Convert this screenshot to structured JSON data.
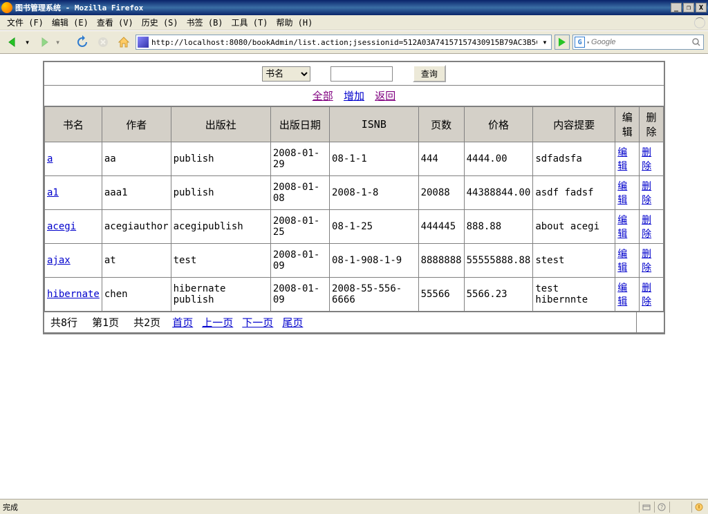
{
  "window": {
    "title": "图书管理系统 - Mozilla Firefox",
    "min": "_",
    "restore": "❐",
    "close": "X"
  },
  "menu": {
    "file": "文件 (F)",
    "edit": "编辑 (E)",
    "view": "查看 (V)",
    "history": "历史 (S)",
    "bookmarks": "书签 (B)",
    "tools": "工具 (T)",
    "help": "帮助 (H)"
  },
  "toolbar": {
    "url": "http://localhost:8080/bookAdmin/list.action;jsessionid=512A03A74157157430915B79AC3B5C",
    "search_placeholder": "Google"
  },
  "page": {
    "search_type": "书名",
    "search_button": "查询",
    "link_all": "全部",
    "link_add": "增加",
    "link_back": "返回",
    "headers": [
      "书名",
      "作者",
      "出版社",
      "出版日期",
      "ISNB",
      "页数",
      "价格",
      "内容提要",
      "编辑",
      "删除"
    ],
    "edit_label": "编辑",
    "delete_label": "删除",
    "rows": [
      {
        "name": "a",
        "author": "aa",
        "publisher": "publish",
        "date": "2008-01-29",
        "isbn": "08-1-1",
        "pages": "444",
        "price": "4444.00",
        "summary": "sdfadsfa"
      },
      {
        "name": "a1",
        "author": "aaa1",
        "publisher": "publish",
        "date": "2008-01-08",
        "isbn": "2008-1-8",
        "pages": "20088",
        "price": "44388844.00",
        "summary": "asdf fadsf"
      },
      {
        "name": "acegi",
        "author": "acegiauthor",
        "publisher": "acegipublish",
        "date": "2008-01-25",
        "isbn": "08-1-25",
        "pages": "444445",
        "price": "888.88",
        "summary": "about acegi"
      },
      {
        "name": "ajax",
        "author": "at",
        "publisher": "test",
        "date": "2008-01-09",
        "isbn": "08-1-908-1-9",
        "pages": "8888888",
        "price": "55555888.88",
        "summary": "stest"
      },
      {
        "name": "hibernate",
        "author": "chen",
        "publisher": "hibernate publish",
        "date": "2008-01-09",
        "isbn": "2008-55-556-6666",
        "pages": "55566",
        "price": "5566.23",
        "summary": "test hibernnte"
      }
    ],
    "pagination": {
      "total": "共8行",
      "current": "第1页",
      "pages": "共2页",
      "first": "首页",
      "prev": "上一页",
      "next": "下一页",
      "last": "尾页"
    }
  },
  "status": {
    "text": "完成"
  }
}
